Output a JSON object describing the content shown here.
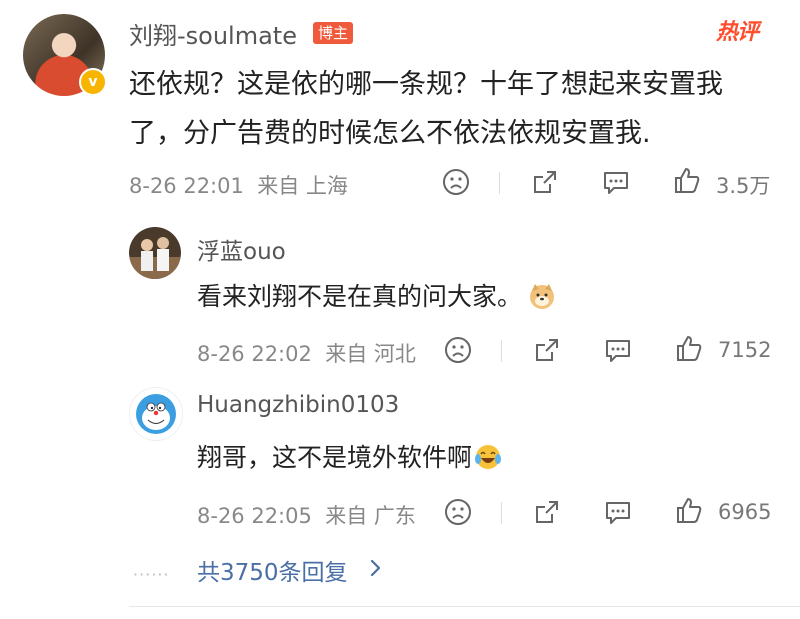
{
  "main_comment": {
    "username": "刘翔-soulmate",
    "badge": "博主",
    "hot_tag": "热评",
    "text": "还依规？这是依的哪一条规？十年了想起来安置我了，分广告费的时候怎么不依法依规安置我.",
    "time": "8-26 22:01",
    "location": "来自 上海",
    "like_count": "3.5万"
  },
  "replies": [
    {
      "username": "浮蓝ouo",
      "text": "看来刘翔不是在真的问大家。",
      "emoji": "doge-emoji",
      "time": "8-26 22:02",
      "location": "来自 河北",
      "like_count": "7152"
    },
    {
      "username": "Huangzhibin0103",
      "text": "翔哥，这不是境外软件啊",
      "emoji": "laugh-cry-emoji",
      "time": "8-26 22:05",
      "location": "来自 广东",
      "like_count": "6965"
    }
  ],
  "more_replies": {
    "dots": "······",
    "label": "共3750条回复"
  },
  "icons": [
    "sad-face-icon",
    "repost-icon",
    "comment-icon",
    "like-icon",
    "chevron-right-icon"
  ],
  "colors": {
    "accent_link": "#4a6fa5",
    "hot_red": "#ff4d2e",
    "badge_bg": "#f05a3c",
    "verified": "#f7b500"
  }
}
